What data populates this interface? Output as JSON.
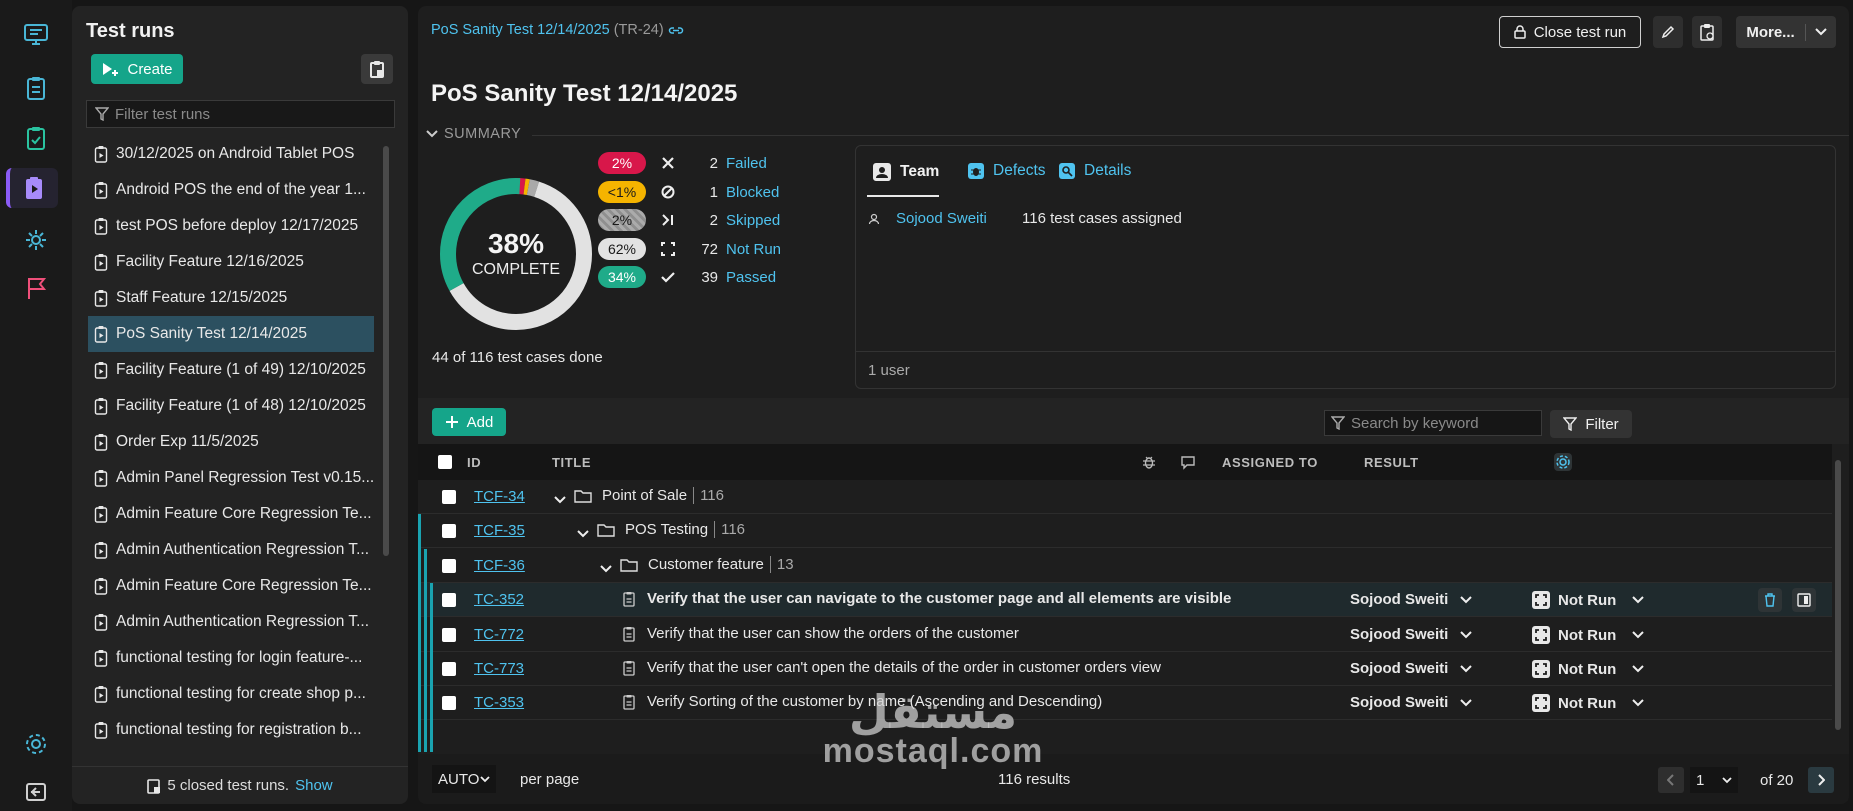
{
  "rail": {
    "items": [
      "dashboard-icon",
      "test-cases-icon",
      "checklist-icon",
      "test-runs-icon",
      "settings-cog-icon",
      "milestones-flag-icon"
    ],
    "active": "test-runs-icon"
  },
  "runs_panel": {
    "title": "Test runs",
    "create_label": "Create",
    "filter_placeholder": "Filter test runs",
    "items": [
      "30/12/2025 on Android Tablet POS",
      "Android POS the end of the year 1...",
      "test POS before deploy 12/17/2025",
      "Facility Feature 12/16/2025",
      "Staff Feature 12/15/2025",
      "PoS Sanity Test 12/14/2025",
      "Facility Feature (1 of 49) 12/10/2025",
      "Facility Feature (1 of 48) 12/10/2025",
      "Order Exp 11/5/2025",
      "Admin Panel Regression Test v0.15...",
      "Admin Feature Core Regression Te...",
      "Admin Authentication Regression T...",
      "Admin Feature Core Regression Te...",
      "Admin Authentication Regression T...",
      "functional testing for login feature-...",
      "functional testing for create shop p...",
      "functional testing for registration b..."
    ],
    "active_index": 5,
    "footer_text": "5 closed test runs.",
    "footer_link": "Show"
  },
  "header": {
    "breadcrumb_link": "PoS Sanity Test 12/14/2025",
    "breadcrumb_id": "(TR-24)",
    "close_label": "Close test run",
    "more_label": "More..."
  },
  "page_title": "PoS Sanity Test 12/14/2025",
  "summary": {
    "label": "SUMMARY",
    "percent": "38%",
    "complete_label": "COMPLETE",
    "done_text": "44 of 116 test cases done",
    "complete_fraction": 0.38,
    "segments": [
      {
        "name": "Failed",
        "fraction": 0.02,
        "color": "#d8174a"
      },
      {
        "name": "Blocked",
        "fraction": 0.009,
        "color": "#f5b400"
      },
      {
        "name": "Skipped",
        "fraction": 0.02,
        "color": "#a9a9a9"
      },
      {
        "name": "Not Run",
        "fraction": 0.62,
        "color": "#e2e2e2"
      },
      {
        "name": "Passed",
        "fraction": 0.34,
        "color": "#1fab89"
      }
    ],
    "stats": [
      {
        "pct": "2%",
        "count": "2",
        "name": "Failed",
        "icon": "x-icon",
        "bg": "#d8174a",
        "fg": "#ffffff"
      },
      {
        "pct": "<1%",
        "count": "1",
        "name": "Blocked",
        "icon": "blocked-icon",
        "bg": "#f5b400",
        "fg": "#1a1a1a"
      },
      {
        "pct": "2%",
        "count": "2",
        "name": "Skipped",
        "icon": "skip-icon",
        "bg": "#8f8f8f",
        "fg": "#1a1a1a"
      },
      {
        "pct": "62%",
        "count": "72",
        "name": "Not Run",
        "icon": "not-run-icon",
        "bg": "#e2e2e2",
        "fg": "#1a1a1a"
      },
      {
        "pct": "34%",
        "count": "39",
        "name": "Passed",
        "icon": "check-icon",
        "bg": "#1fab89",
        "fg": "#ffffff"
      }
    ]
  },
  "team_card": {
    "tabs": [
      "Team",
      "Defects",
      "Details"
    ],
    "user": "Sojood Sweiti",
    "assigned": "116 test cases assigned",
    "footer": "1 user"
  },
  "toolbar": {
    "add_label": "Add",
    "search_placeholder": "Search by keyword",
    "filter_label": "Filter"
  },
  "table": {
    "headers": {
      "id": "ID",
      "title": "TITLE",
      "assigned": "ASSIGNED TO",
      "result": "RESULT"
    },
    "rows": [
      {
        "id": "TCF-34",
        "title": "Point of Sale",
        "count": "116",
        "kind": "folder"
      },
      {
        "id": "TCF-35",
        "title": "POS Testing",
        "count": "116",
        "kind": "folder"
      },
      {
        "id": "TCF-36",
        "title": "Customer feature",
        "count": "13",
        "kind": "folder"
      },
      {
        "id": "TC-352",
        "title": "Verify that the user can navigate to the customer page and all elements are visible",
        "assignee": "Sojood Sweiti",
        "result": "Not Run",
        "kind": "case",
        "bold": true
      },
      {
        "id": "TC-772",
        "title": "Verify that the user can show the orders of the customer",
        "assignee": "Sojood Sweiti",
        "result": "Not Run",
        "kind": "case"
      },
      {
        "id": "TC-773",
        "title": "Verify that the user can't open the details of the order in customer orders view",
        "assignee": "Sojood Sweiti",
        "result": "Not Run",
        "kind": "case"
      },
      {
        "id": "TC-353",
        "title": "Verify Sorting of the customer by name (Ascending and Descending)",
        "assignee": "Sojood Sweiti",
        "result": "Not Run",
        "kind": "case"
      }
    ]
  },
  "pager": {
    "per_page_value": "AUTO",
    "per_page_label": "per page",
    "results": "116 results",
    "page": "1",
    "of_pages": "of 20"
  },
  "watermark": {
    "arabic": "مستقل",
    "latin": "mostaql.com"
  }
}
